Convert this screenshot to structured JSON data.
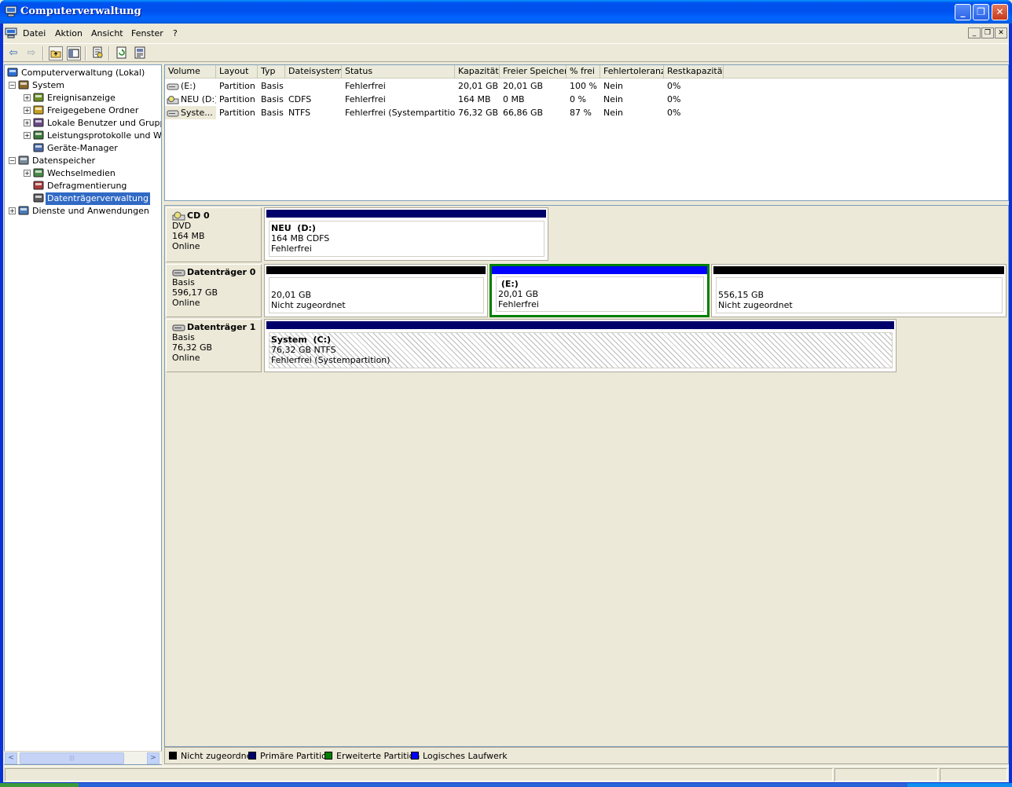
{
  "window": {
    "title": "Computerverwaltung",
    "min_label": "_",
    "max_label": "❐",
    "close_label": "✕"
  },
  "menu": {
    "items": [
      "Datei",
      "Aktion",
      "Ansicht",
      "Fenster",
      "?"
    ],
    "mdi_min": "_",
    "mdi_restore": "❐",
    "mdi_close": "✕"
  },
  "toolbar": {
    "buttons": [
      "back-icon",
      "forward-icon",
      "up-folder-icon",
      "show-hide-tree-icon",
      "properties-icon",
      "refresh-icon",
      "help-icon"
    ]
  },
  "tree": {
    "items": [
      {
        "label": "Computerverwaltung (Lokal)",
        "icon": "computer-icon",
        "expander": ""
      },
      {
        "label": "System",
        "icon": "tools-icon",
        "expander": "−"
      },
      {
        "label": "Ereignisanzeige",
        "icon": "event-viewer-icon",
        "expander": "+"
      },
      {
        "label": "Freigegebene Ordner",
        "icon": "shared-folders-icon",
        "expander": "+"
      },
      {
        "label": "Lokale Benutzer und Gruppen",
        "icon": "users-icon",
        "expander": "+"
      },
      {
        "label": "Leistungsprotokolle und Warnungen",
        "icon": "performance-logs-icon",
        "expander": "+"
      },
      {
        "label": "Geräte-Manager",
        "icon": "device-manager-icon",
        "expander": ""
      },
      {
        "label": "Datenspeicher",
        "icon": "storage-icon",
        "expander": "−"
      },
      {
        "label": "Wechselmedien",
        "icon": "removable-storage-icon",
        "expander": "+"
      },
      {
        "label": "Defragmentierung",
        "icon": "defrag-icon",
        "expander": ""
      },
      {
        "label": "Datenträgerverwaltung",
        "icon": "disk-management-icon",
        "expander": "",
        "selected": true
      },
      {
        "label": "Dienste und Anwendungen",
        "icon": "services-icon",
        "expander": "+"
      }
    ],
    "scroll_left": "<",
    "scroll_right": ">",
    "scroll_grip": "|||"
  },
  "volumes": {
    "columns": [
      "Volume",
      "Layout",
      "Typ",
      "Dateisystem",
      "Status",
      "Kapazität",
      "Freier Speicher",
      "% frei",
      "Fehlertoleranz",
      "Restkapazität"
    ],
    "rows": [
      {
        "volume": "(E:)",
        "icon": "drive-icon",
        "layout": "Partition",
        "typ": "Basis",
        "dateisystem": "",
        "status": "Fehlerfrei",
        "kapazitaet": "20,01 GB",
        "frei": "20,01 GB",
        "prozent": "100 %",
        "fehlertoleranz": "Nein",
        "rest": "0%"
      },
      {
        "volume": "NEU (D:)",
        "icon": "cd-drive-icon",
        "layout": "Partition",
        "typ": "Basis",
        "dateisystem": "CDFS",
        "status": "Fehlerfrei",
        "kapazitaet": "164 MB",
        "frei": "0 MB",
        "prozent": "0 %",
        "fehlertoleranz": "Nein",
        "rest": "0%"
      },
      {
        "volume": "Syste...",
        "icon": "drive-icon",
        "layout": "Partition",
        "typ": "Basis",
        "dateisystem": "NTFS",
        "status": "Fehlerfrei (Systempartition)",
        "kapazitaet": "76,32 GB",
        "frei": "66,86 GB",
        "prozent": "87 %",
        "fehlertoleranz": "Nein",
        "rest": "0%"
      }
    ]
  },
  "disks": [
    {
      "name": "CD 0",
      "icon": "cd-icon",
      "type": "DVD",
      "size": "164 MB",
      "state": "Online",
      "volumes": [
        {
          "title": "NEU  (D:)",
          "line2": "164 MB CDFS",
          "line3": "Fehlerfrei",
          "bar_color": "#00006b",
          "hatched": false,
          "selected": false
        }
      ]
    },
    {
      "name": "Datenträger 0",
      "icon": "hard-disk-icon",
      "type": "Basis",
      "size": "596,17 GB",
      "state": "Online",
      "volumes": [
        {
          "title": "",
          "line2": "20,01 GB",
          "line3": "Nicht zugeordnet",
          "bar_color": "#000000",
          "hatched": false,
          "selected": false
        },
        {
          "title": " (E:)",
          "line2": "20,01 GB",
          "line3": "Fehlerfrei",
          "bar_color": "#0000ff",
          "hatched": false,
          "selected": true
        },
        {
          "title": "",
          "line2": "556,15 GB",
          "line3": "Nicht zugeordnet",
          "bar_color": "#000000",
          "hatched": false,
          "selected": false
        }
      ]
    },
    {
      "name": "Datenträger 1",
      "icon": "hard-disk-icon",
      "type": "Basis",
      "size": "76,32 GB",
      "state": "Online",
      "volumes": [
        {
          "title": "System  (C:)",
          "line2": "76,32 GB NTFS",
          "line3": "Fehlerfrei (Systempartition)",
          "bar_color": "#00006b",
          "hatched": true,
          "selected": false
        }
      ]
    }
  ],
  "legend": [
    {
      "label": "Nicht zugeordnet",
      "color": "#000000"
    },
    {
      "label": "Primäre Partition",
      "color": "#00006b"
    },
    {
      "label": "Erweiterte Partition",
      "color": "#008000"
    },
    {
      "label": "Logisches Laufwerk",
      "color": "#0000ff"
    }
  ],
  "colors": {
    "extended_partition_border": "#008000",
    "selection": "#316ac5"
  }
}
